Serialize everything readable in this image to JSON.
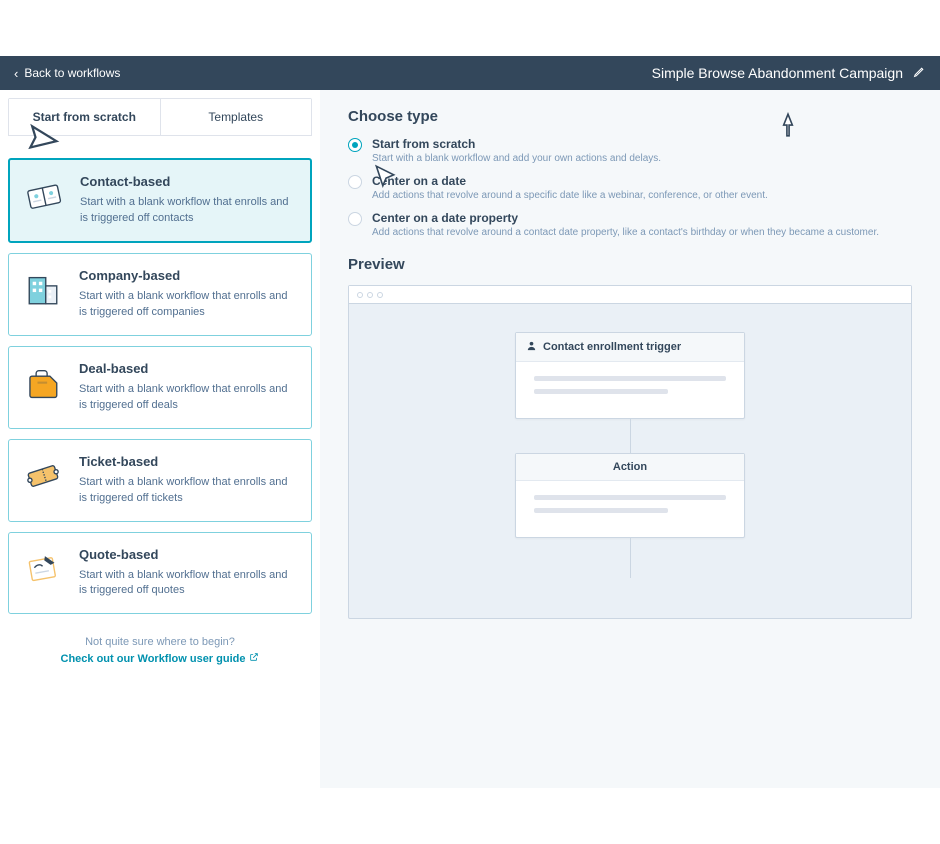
{
  "header": {
    "back": "Back to workflows",
    "title": "Simple Browse Abandonment Campaign"
  },
  "tabs": [
    {
      "label": "Start from scratch"
    },
    {
      "label": "Templates"
    }
  ],
  "cards": [
    {
      "title": "Contact-based",
      "desc": "Start with a blank workflow that enrolls and is triggered off contacts"
    },
    {
      "title": "Company-based",
      "desc": "Start with a blank workflow that enrolls and is triggered off companies"
    },
    {
      "title": "Deal-based",
      "desc": "Start with a blank workflow that enrolls and is triggered off deals"
    },
    {
      "title": "Ticket-based",
      "desc": "Start with a blank workflow that enrolls and is triggered off tickets"
    },
    {
      "title": "Quote-based",
      "desc": "Start with a blank workflow that enrolls and is triggered off quotes"
    }
  ],
  "help": {
    "prompt": "Not quite sure where to begin?",
    "link": "Check out our Workflow user guide"
  },
  "choose": {
    "heading": "Choose type",
    "options": [
      {
        "label": "Start from scratch",
        "sub": "Start with a blank workflow and add your own actions and delays."
      },
      {
        "label": "Center on a date",
        "sub": "Add actions that revolve around a specific date like a webinar, conference, or other event."
      },
      {
        "label": "Center on a date property",
        "sub": "Add actions that revolve around a contact date property, like a contact's birthday or when they became a customer."
      }
    ]
  },
  "preview": {
    "heading": "Preview",
    "trigger": "Contact enrollment trigger",
    "action": "Action"
  }
}
